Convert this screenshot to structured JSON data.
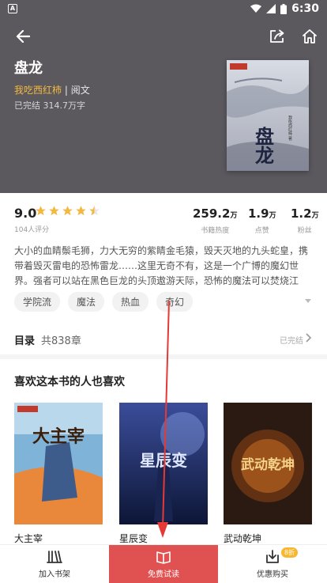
{
  "status_bar": {
    "carrier_mark": "A",
    "time": "6:30"
  },
  "book": {
    "title": "盘龙",
    "author": "我吃西红柿",
    "category": "| 阅文",
    "status": "已完结 314.7万字",
    "cover_text": "盘龙",
    "cover_author": "我吃西红柿 著",
    "rating": "9.0",
    "rating_count": "104人评分",
    "star_value": 4.5,
    "stats": [
      {
        "num": "259.2",
        "unit": "万",
        "label": "书籍热度"
      },
      {
        "num": "1.9",
        "unit": "万",
        "label": "点赞"
      },
      {
        "num": "1.2",
        "unit": "万",
        "label": "粉丝"
      }
    ],
    "description": "大小的血睛鬃毛狮，力大无穷的紫睛金毛猿，毁天灭地的九头蛇皇，携带着毁灭雷电的恐怖雷龙……这里无奇不有，这是一个广博的魔幻世界。强者可以站在黑色巨龙的头顶遨游天际，恐怖的魔法可以焚烧江河，可",
    "tags": [
      "学院流",
      "魔法",
      "热血",
      "奇幻"
    ]
  },
  "catalog": {
    "label": "目录",
    "count": "共838章",
    "status": "已完结"
  },
  "recommend": {
    "heading": "喜欢这本书的人也喜欢",
    "books": [
      {
        "title": "大主宰",
        "cover_text": "大主宰"
      },
      {
        "title": "星辰变",
        "cover_text": "星辰变"
      },
      {
        "title": "武动乾坤",
        "cover_text": "武动乾坤"
      }
    ]
  },
  "bottom_bar": {
    "shelf": "加入书架",
    "read": "免费试读",
    "buy": "优惠购买",
    "buy_badge": "8折"
  },
  "colors": {
    "hero_bg": "#5b595e",
    "accent": "#e05251",
    "author": "#f2b840",
    "star": "#f2b840",
    "badge": "#f7b731"
  }
}
